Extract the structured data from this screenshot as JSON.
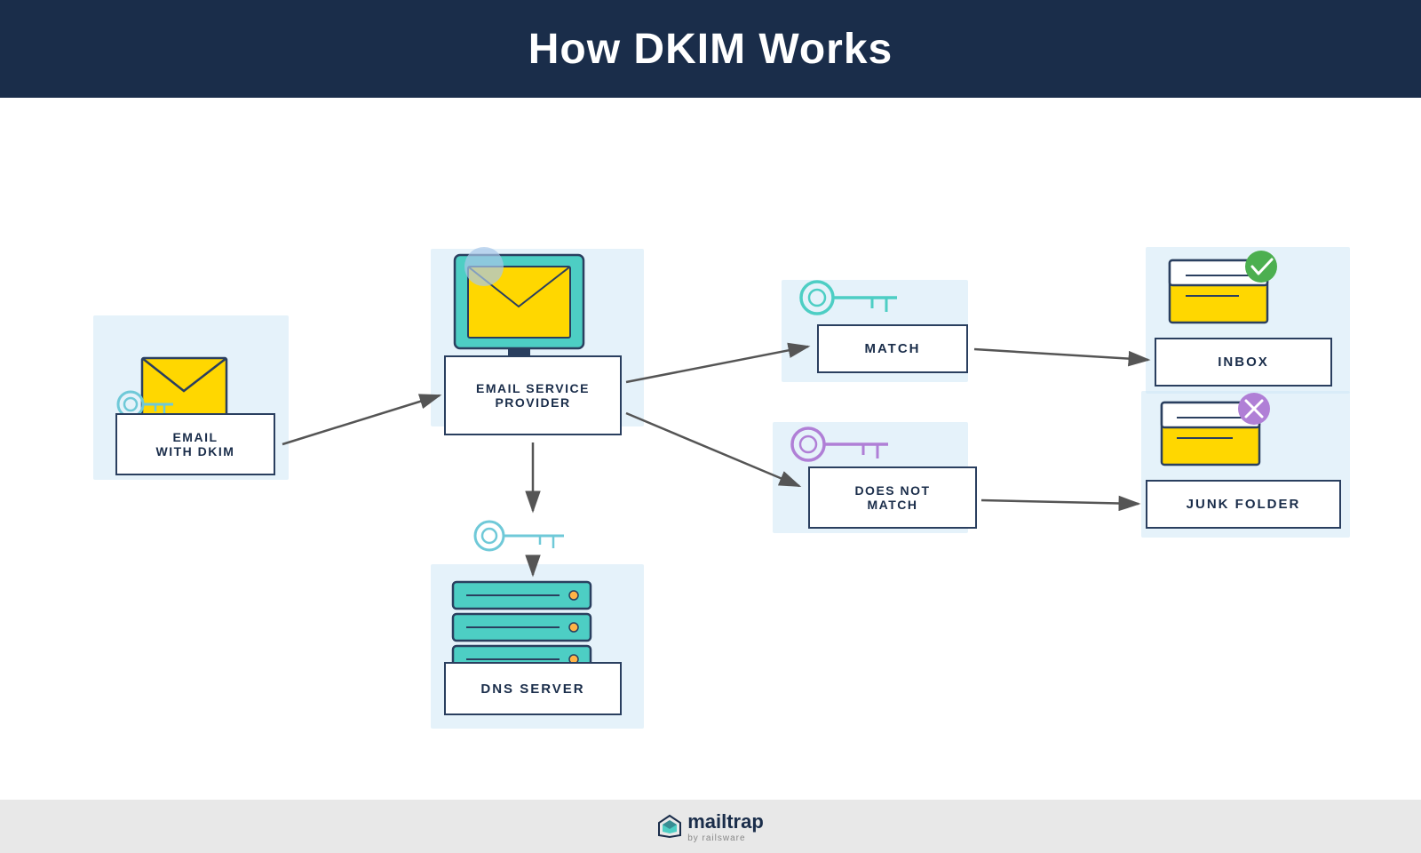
{
  "header": {
    "title": "How DKIM Works"
  },
  "diagram": {
    "boxes": {
      "email": "EMAIL\nWITH DKIM",
      "esp": "EMAIL SERVICE\nPROVIDER",
      "match": "MATCH",
      "nomatch": "DOES NOT\nMATCH",
      "inbox": "INBOX",
      "junk": "JUNK FOLDER",
      "dns": "DNS SERVER"
    }
  },
  "footer": {
    "brand": "mailtrap",
    "sub": "by railsware"
  }
}
